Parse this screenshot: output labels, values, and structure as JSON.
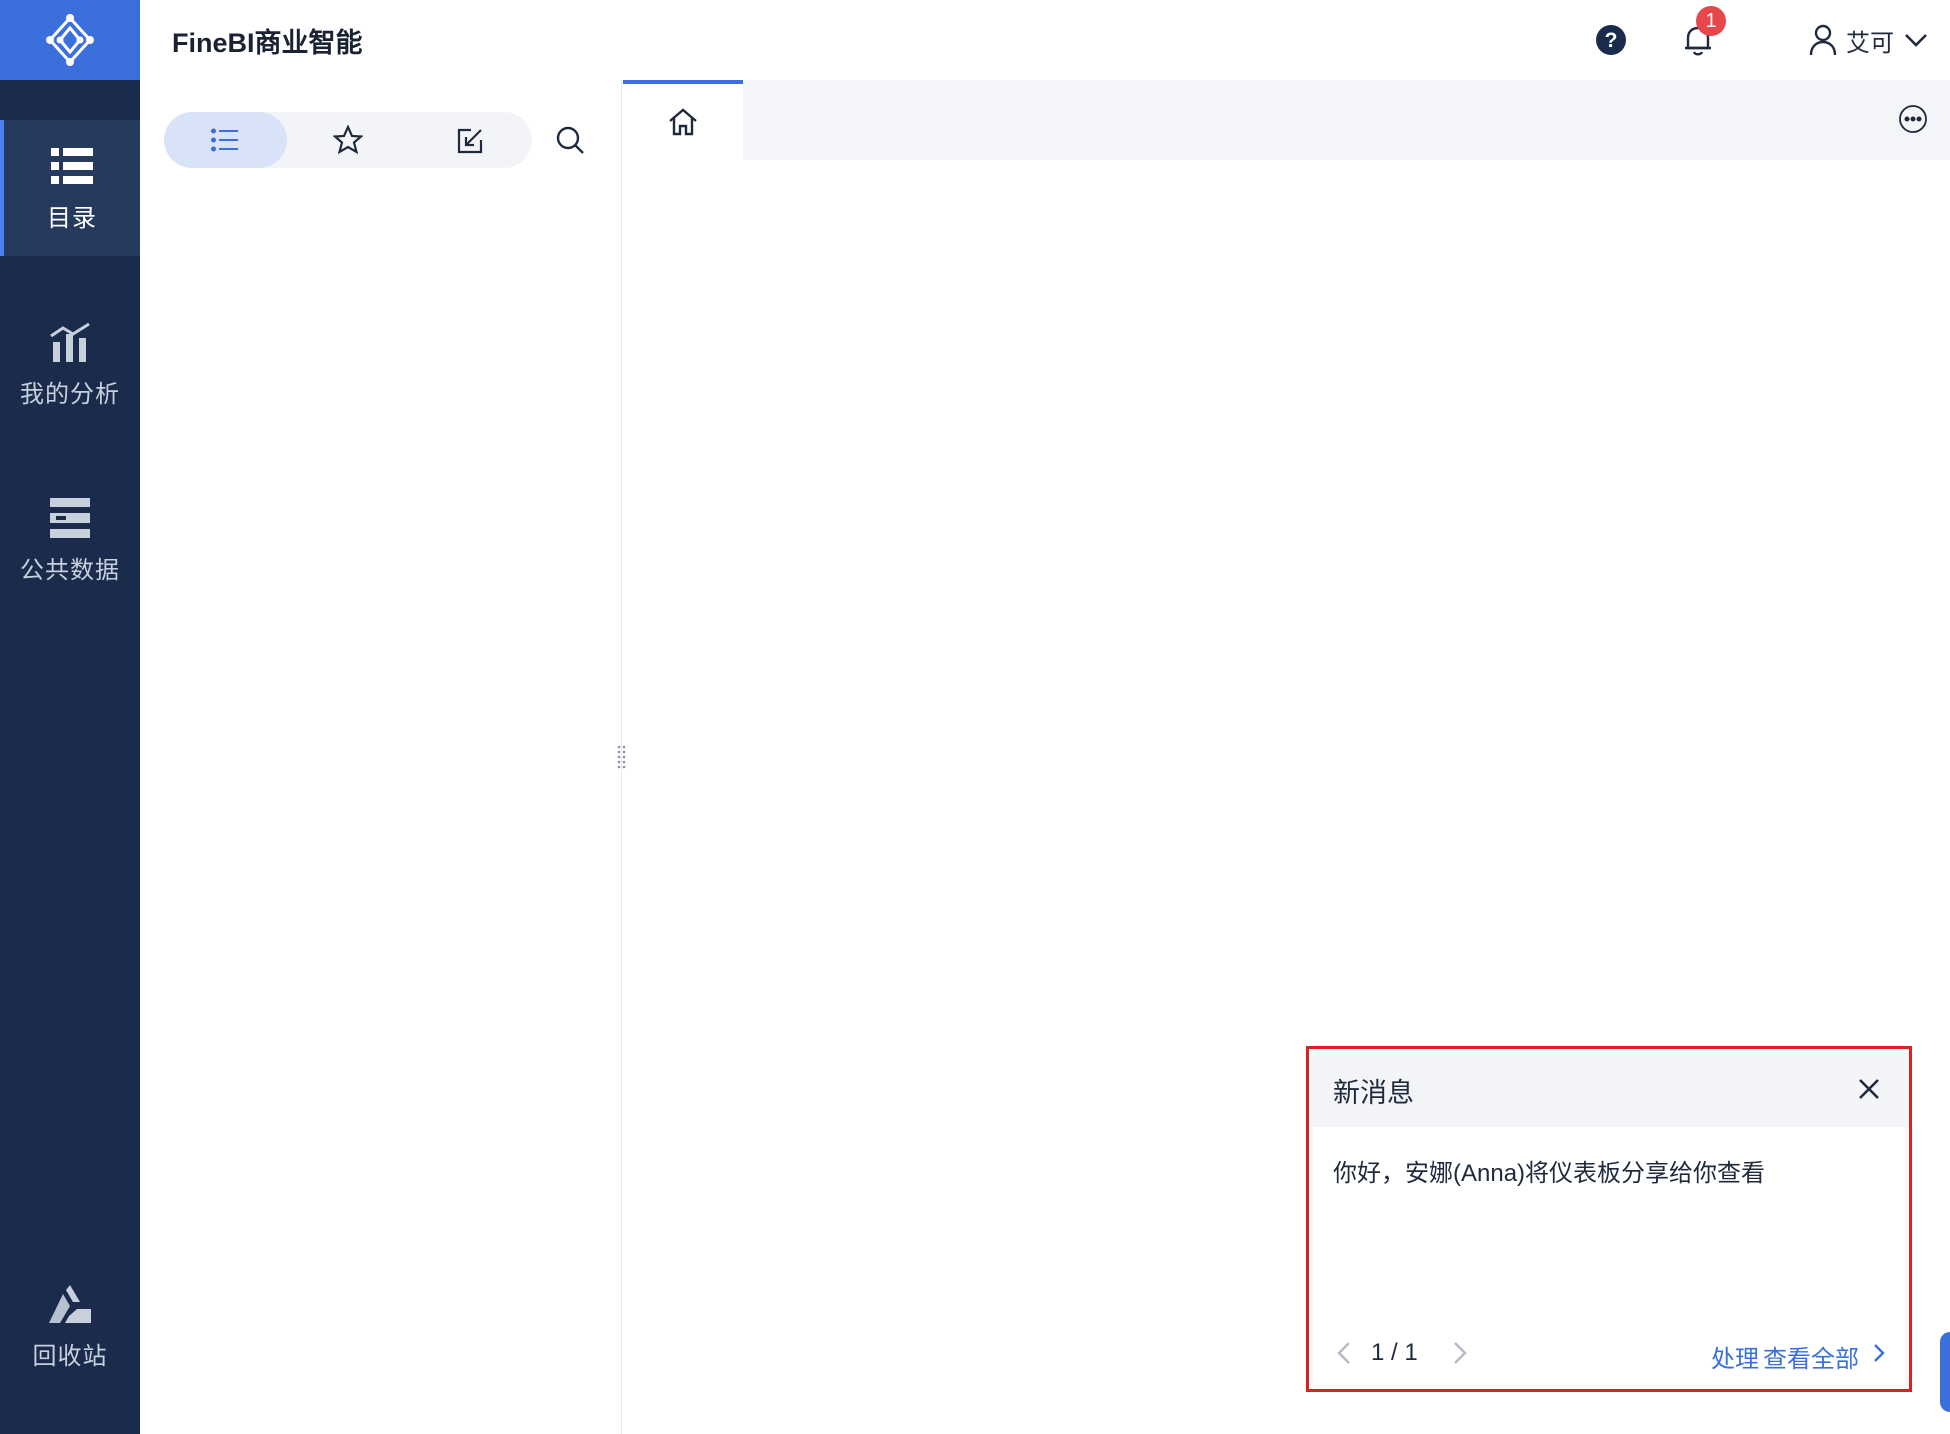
{
  "app": {
    "title": "FineBI商业智能"
  },
  "colors": {
    "sidebar": "#1a2b4c",
    "accent": "#3a6fdc",
    "badge": "#e5474b",
    "highlight_border": "#e02020"
  },
  "sidebar": {
    "logo_icon": "network-logo-icon",
    "items": [
      {
        "label": "目录",
        "icon": "list-icon",
        "active": true
      },
      {
        "label": "我的分析",
        "icon": "chart-icon",
        "active": false
      },
      {
        "label": "公共数据",
        "icon": "database-icon",
        "active": false
      },
      {
        "label": "回收站",
        "icon": "recycle-icon",
        "active": false
      }
    ]
  },
  "header": {
    "help_icon": "help-icon",
    "notification_count": "1",
    "user_name": "艾可"
  },
  "directory": {
    "segments": [
      {
        "icon": "list-icon",
        "active": true
      },
      {
        "icon": "star-icon",
        "active": false
      },
      {
        "icon": "edit-icon",
        "active": false
      }
    ]
  },
  "tabs": {
    "home_icon": "home-icon"
  },
  "notification": {
    "title": "新消息",
    "message": "你好，安娜(Anna)将仪表板分享给你查看",
    "pager": "1 / 1",
    "process_label": "处理",
    "view_all_label": "查看全部"
  }
}
